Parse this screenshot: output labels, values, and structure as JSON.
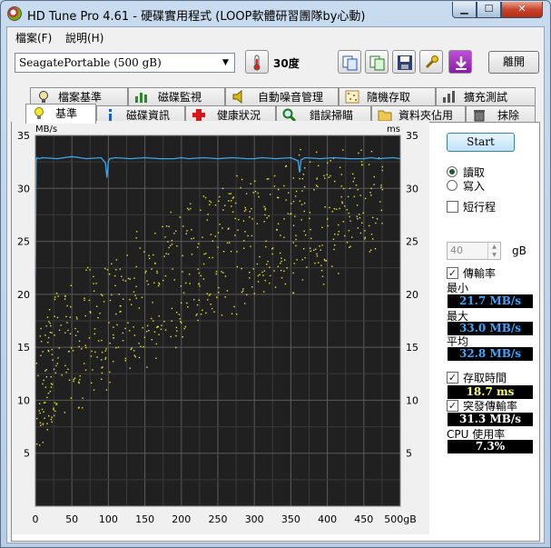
{
  "window": {
    "title": "HD Tune Pro 4.61 - 硬碟實用程式 (LOOP軟體研習團隊by心動)",
    "min": "▁",
    "max": "☐",
    "close": "✕"
  },
  "menu": [
    "檔案(F)",
    "說明(H)"
  ],
  "toolbar": {
    "drive": "SeagatePortable (500 gB)",
    "temperature": "30度",
    "exit_label": "離開"
  },
  "tabs_top": [
    "檔案基準",
    "磁碟監視",
    "自動噪音管理",
    "隨機存取",
    "擴充測試"
  ],
  "tabs_bottom": [
    "基準",
    "磁碟資訊",
    "健康狀況",
    "錯誤掃瞄",
    "資料夾佔用",
    "抹除"
  ],
  "side": {
    "start_label": "Start",
    "read_label": "讀取",
    "write_label": "寫入",
    "short_stroke_label": "短行程",
    "short_stroke_value": "40",
    "short_stroke_unit": "gB",
    "transfer_rate_label": "傳輸率",
    "min_label": "最小",
    "min_value": "21.7 MB/s",
    "max_label": "最大",
    "max_value": "33.0 MB/s",
    "avg_label": "平均",
    "avg_value": "32.8 MB/s",
    "access_time_label": "存取時間",
    "access_time_value": "18.7 ms",
    "burst_label": "突發傳輸率",
    "burst_value": "31.3 MB/s",
    "cpu_label": "CPU 使用率",
    "cpu_value": "7.3%"
  },
  "colors": {
    "transfer_line": "#3aa7e8",
    "access_points": "#e8e82a",
    "value_blue": "#36a8ff",
    "value_yellow": "#ffff66",
    "value_white": "#ffffff"
  },
  "chart_data": {
    "type": "line",
    "left_unit": "MB/s",
    "right_unit": "ms",
    "x_unit": "gB",
    "xlim": [
      0,
      500
    ],
    "ylim": [
      0,
      35
    ],
    "x_ticks": [
      "0",
      "50",
      "100",
      "150",
      "200",
      "250",
      "300",
      "350",
      "400",
      "450",
      "500gB"
    ],
    "y_ticks_left": [
      "5",
      "10",
      "15",
      "20",
      "25",
      "30",
      "35"
    ],
    "y_ticks_right": [
      "5",
      "10",
      "15",
      "20",
      "25",
      "30",
      "35"
    ],
    "grid": true,
    "transfer_rate": {
      "x": [
        0,
        1,
        2,
        5,
        10,
        30,
        50,
        70,
        90,
        96,
        98,
        100,
        102,
        110,
        130,
        150,
        170,
        190,
        200,
        210,
        230,
        250,
        270,
        290,
        300,
        310,
        330,
        350,
        360,
        362,
        364,
        370,
        390,
        410,
        430,
        450,
        460,
        470,
        490,
        500
      ],
      "y": [
        21.7,
        32.6,
        32.9,
        32.8,
        32.9,
        32.8,
        33.0,
        32.8,
        32.9,
        32.4,
        31.0,
        32.6,
        32.8,
        32.9,
        32.8,
        32.9,
        32.8,
        32.8,
        32.9,
        32.8,
        32.9,
        32.8,
        32.9,
        32.8,
        32.8,
        32.9,
        32.8,
        32.9,
        32.6,
        31.5,
        32.7,
        32.9,
        32.8,
        32.9,
        32.8,
        32.8,
        32.9,
        32.8,
        32.9,
        32.8
      ]
    },
    "access_time_ms": {
      "description_points": "scatter, roughly 6–17 ms at 0 gB rising to 20–33 ms near 470 gB",
      "x": [
        5,
        10,
        15,
        20,
        25,
        30,
        40,
        50,
        60,
        70,
        80,
        90,
        100,
        110,
        120,
        130,
        140,
        150,
        160,
        170,
        180,
        190,
        200,
        210,
        220,
        230,
        240,
        250,
        260,
        270,
        280,
        290,
        300,
        310,
        320,
        330,
        340,
        350,
        360,
        370,
        380,
        390,
        400,
        410,
        420,
        430,
        440,
        450,
        460,
        470
      ],
      "y": [
        9,
        11,
        13,
        12,
        14,
        15,
        14,
        16,
        15,
        17,
        16,
        18,
        17,
        18,
        19,
        18,
        20,
        19,
        20,
        21,
        22,
        21,
        22,
        23,
        22,
        24,
        23,
        24,
        25,
        24,
        26,
        25,
        26,
        25,
        27,
        26,
        27,
        26,
        28,
        27,
        28,
        27,
        29,
        28,
        30,
        29,
        30,
        31,
        30,
        32
      ]
    }
  }
}
